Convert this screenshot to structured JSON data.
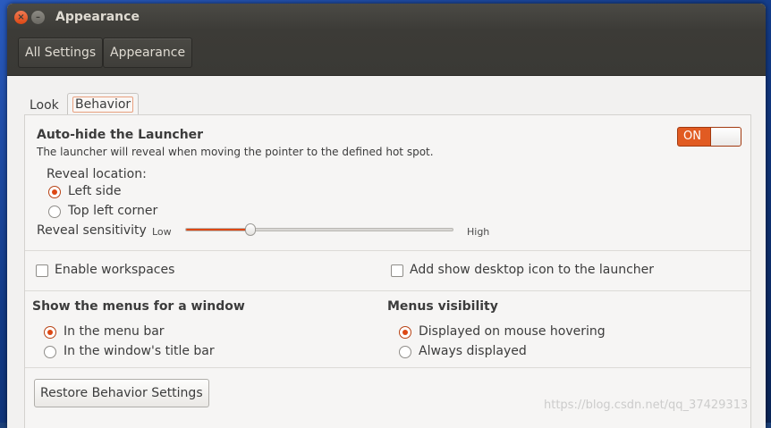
{
  "window": {
    "title": "Appearance",
    "close_glyph": "×",
    "minimize_glyph": "–"
  },
  "toolbar": {
    "breadcrumbs": [
      "All Settings",
      "Appearance"
    ]
  },
  "tabs": {
    "look": "Look",
    "behavior": "Behavior",
    "active": "Behavior"
  },
  "auto_hide": {
    "title": "Auto-hide the Launcher",
    "description": "The launcher will reveal when moving the pointer to the defined hot spot.",
    "toggle_label": "ON",
    "toggle_state": true,
    "reveal_location_label": "Reveal location:",
    "reveal_options": [
      {
        "label": "Left side",
        "selected": true
      },
      {
        "label": "Top left corner",
        "selected": false
      }
    ],
    "sensitivity_label": "Reveal sensitivity",
    "sensitivity_low": "Low",
    "sensitivity_high": "High",
    "sensitivity_value": 0.24
  },
  "checkboxes": {
    "enable_workspaces": {
      "label": "Enable workspaces",
      "checked": false
    },
    "show_desktop_icon": {
      "label": "Add show desktop icon to the launcher",
      "checked": false
    }
  },
  "menus": {
    "show_title": "Show the menus for a window",
    "show_options": [
      {
        "label": "In the menu bar",
        "selected": true
      },
      {
        "label": "In the window's title bar",
        "selected": false
      }
    ],
    "visibility_title": "Menus visibility",
    "visibility_options": [
      {
        "label": "Displayed on mouse hovering",
        "selected": true
      },
      {
        "label": "Always displayed",
        "selected": false
      }
    ]
  },
  "restore_button": "Restore Behavior Settings",
  "watermark": "https://blog.csdn.net/qq_37429313",
  "colors": {
    "accent": "#dd4814",
    "titlebar": "#3c3b37",
    "window_bg": "#f2f1f0"
  }
}
